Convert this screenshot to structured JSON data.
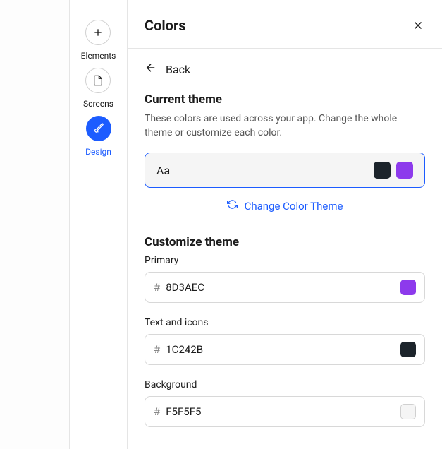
{
  "sidebar": {
    "items": [
      {
        "label": "Elements"
      },
      {
        "label": "Screens"
      },
      {
        "label": "Design"
      }
    ]
  },
  "panel": {
    "title": "Colors",
    "back_label": "Back",
    "current_theme": {
      "title": "Current theme",
      "desc": "These colors are used across your app. Change the whole theme or customize each color.",
      "sample_text": "Aa",
      "swatch1": "#1c242b",
      "swatch2": "#8d3aec"
    },
    "change_theme_label": "Change Color Theme",
    "customize": {
      "title": "Customize theme",
      "fields": [
        {
          "label": "Primary",
          "hex": "8D3AEC",
          "color": "#8d3aec",
          "border": false
        },
        {
          "label": "Text and icons",
          "hex": "1C242B",
          "color": "#1c242b",
          "border": false
        },
        {
          "label": "Background",
          "hex": "F5F5F5",
          "color": "#f5f5f5",
          "border": true
        }
      ]
    }
  }
}
